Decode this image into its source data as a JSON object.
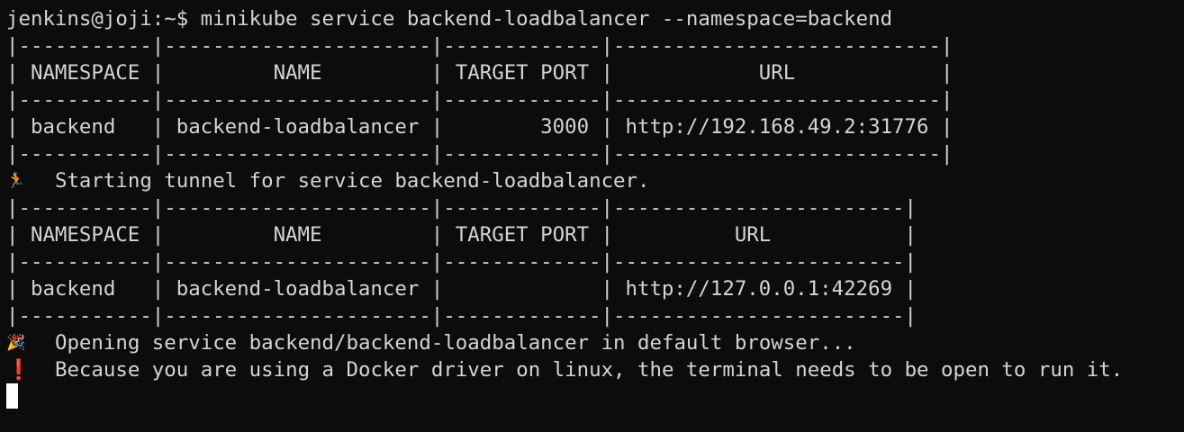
{
  "colors": {
    "background": "#0c0c0c",
    "foreground": "#d4d4d4",
    "cursor": "#ffffff",
    "warning_icon": "#e02424"
  },
  "prompt": {
    "text": "jenkins@joji:~$ minikube service backend-loadbalancer --namespace=backend"
  },
  "table1": {
    "lines": [
      "|-----------|----------------------|-------------|---------------------------|",
      "| NAMESPACE |         NAME         | TARGET PORT |            URL            |",
      "|-----------|----------------------|-------------|---------------------------|",
      "| backend   | backend-loadbalancer |        3000 | http://192.168.49.2:31776 |",
      "|-----------|----------------------|-------------|---------------------------|"
    ]
  },
  "tunnel_message": {
    "icon": "runner-icon",
    "glyph": "🏃",
    "text": "  Starting tunnel for service backend-loadbalancer."
  },
  "table2": {
    "lines": [
      "|-----------|----------------------|-------------|------------------------|",
      "| NAMESPACE |         NAME         | TARGET PORT |          URL           |",
      "|-----------|----------------------|-------------|------------------------|",
      "| backend   | backend-loadbalancer |             | http://127.0.0.1:42269 |",
      "|-----------|----------------------|-------------|------------------------|"
    ]
  },
  "opening_message": {
    "icon": "party-popper-icon",
    "glyph": "🎉",
    "text": "  Opening service backend/backend-loadbalancer in default browser..."
  },
  "warning_message": {
    "icon": "exclamation-icon",
    "glyph": "❗",
    "text": "  Because you are using a Docker driver on linux, the terminal needs to be open to run it."
  }
}
